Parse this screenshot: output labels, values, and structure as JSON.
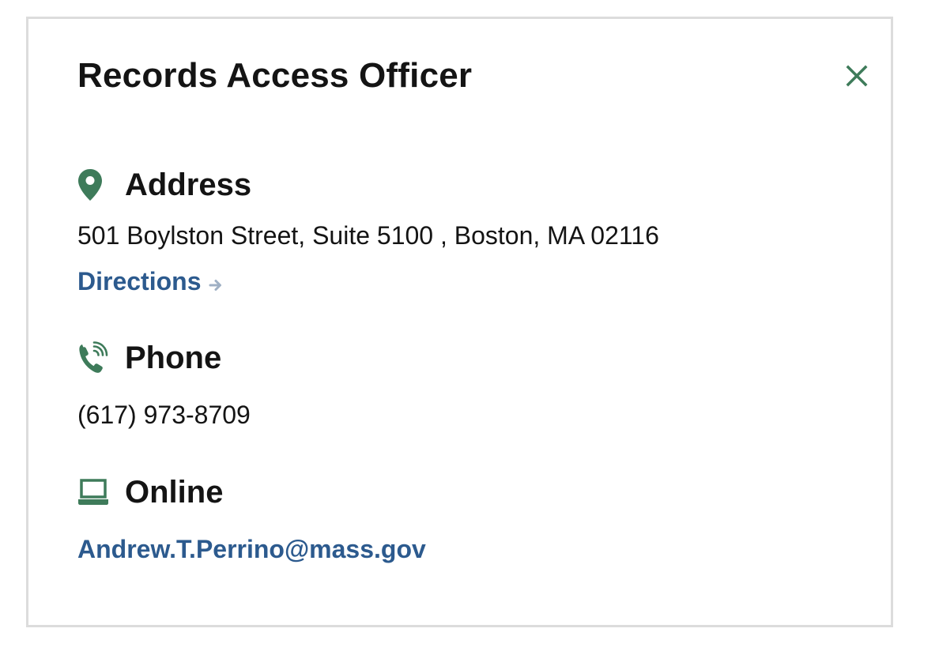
{
  "card": {
    "title": "Records Access Officer",
    "close_icon": "close-icon"
  },
  "address": {
    "heading": "Address",
    "icon": "map-pin-icon",
    "text": "501 Boylston Street, Suite 5100 , Boston, MA 02116",
    "directions_label": "Directions",
    "directions_icon": "arrow-right-icon"
  },
  "phone": {
    "heading": "Phone",
    "icon": "phone-icon",
    "number": "(617) 973-8709"
  },
  "online": {
    "heading": "Online",
    "icon": "laptop-icon",
    "email": "Andrew.T.Perrino@mass.gov"
  },
  "colors": {
    "accent_green": "#3e7b5a",
    "link_blue": "#2c5a8e",
    "border": "#dcdcdc"
  }
}
